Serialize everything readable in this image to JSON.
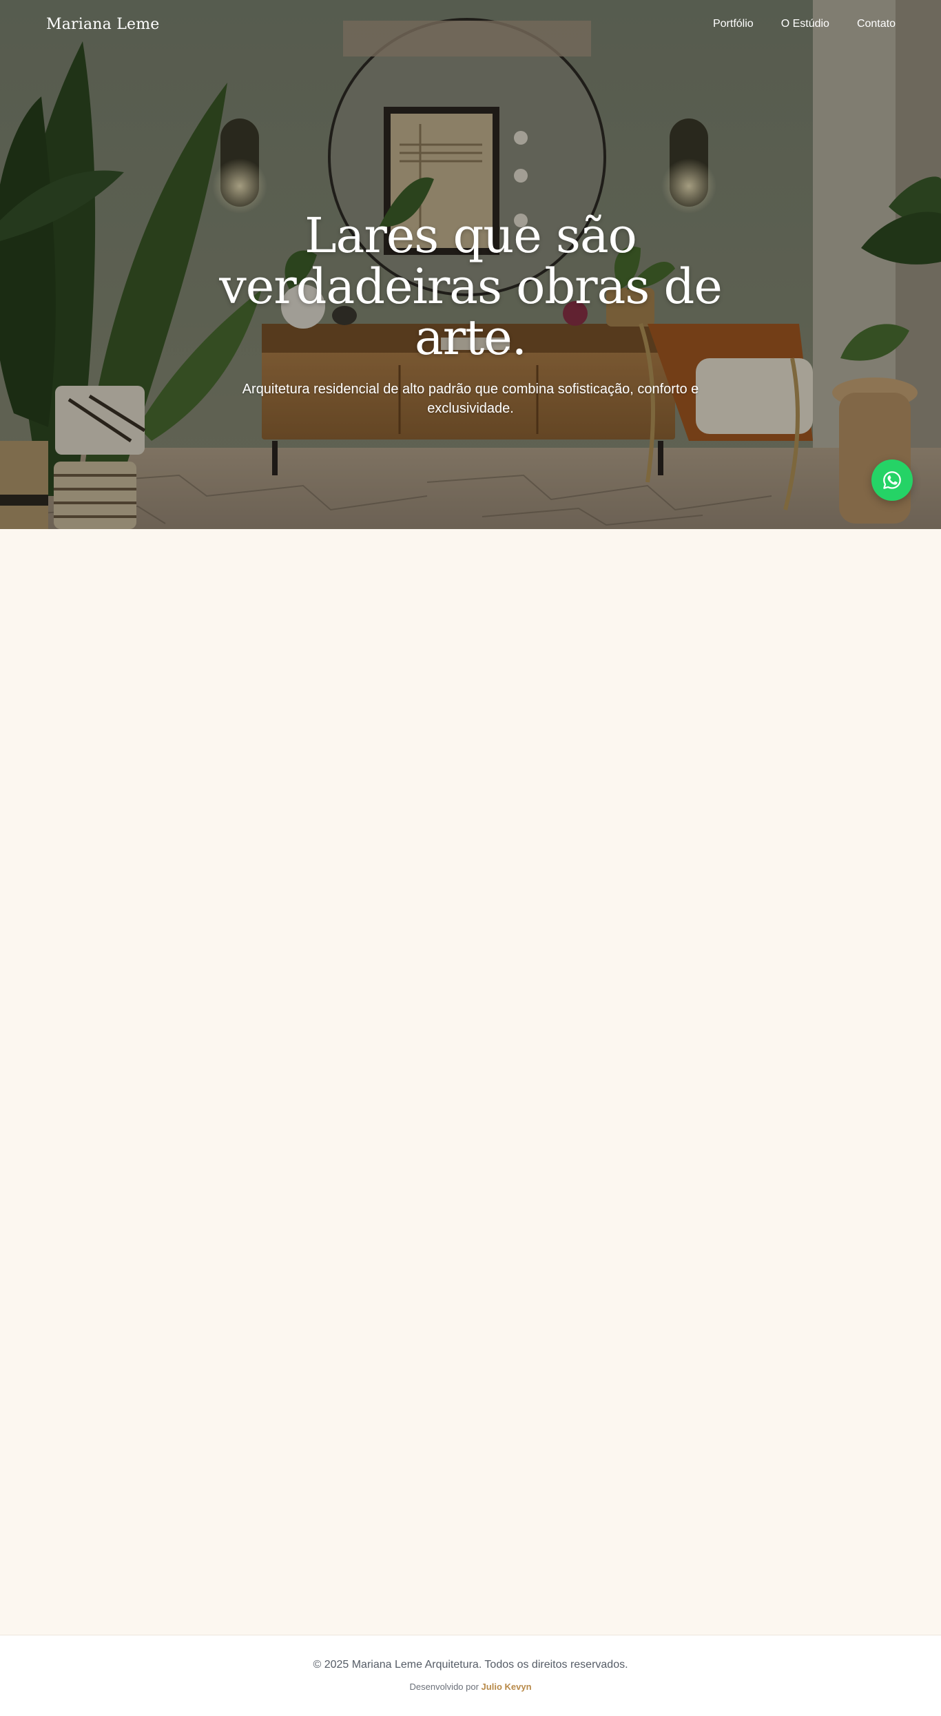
{
  "header": {
    "logo": "Mariana Leme",
    "nav": [
      {
        "label": "Portfólio"
      },
      {
        "label": "O Estúdio"
      },
      {
        "label": "Contato"
      }
    ]
  },
  "hero": {
    "title": "Lares que são verdadeiras obras de arte.",
    "subtitle": "Arquitetura residencial de alto padrão que combina sofisticação, conforto e exclusividade.",
    "background_icon": "living-room-photo"
  },
  "whatsapp": {
    "icon": "whatsapp-icon",
    "color": "#25d366"
  },
  "footer": {
    "copyright": "© 2025 Mariana Leme Arquitetura. Todos os direitos reservados.",
    "credit_prefix": "Desenvolvido por",
    "credit_name": "Julio Kevyn",
    "accent_color": "#b88a4a"
  },
  "colors": {
    "page_background": "#fcf7f0",
    "footer_background": "#ffffff"
  }
}
